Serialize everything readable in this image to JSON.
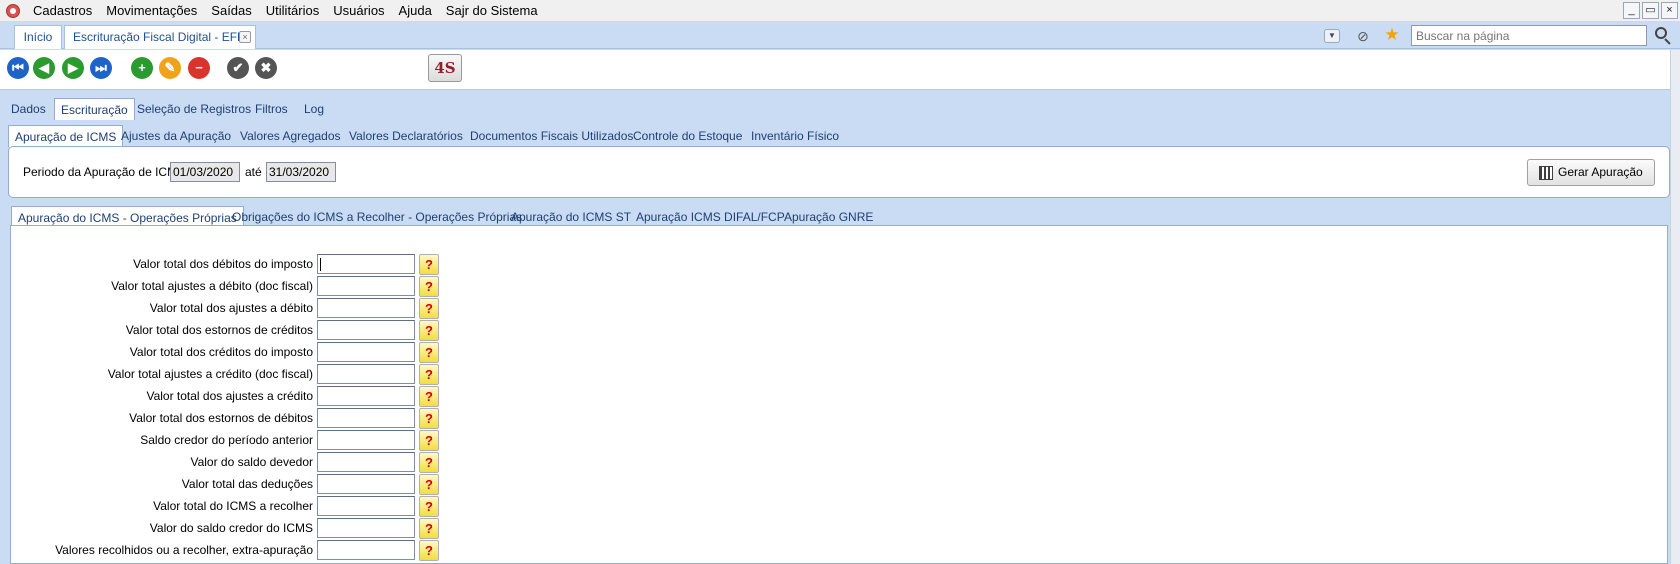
{
  "menu": {
    "items": [
      "Cadastros",
      "Movimentações",
      "Saídas",
      "Utilitários",
      "Usuários",
      "Ajuda",
      "Sajr do Sistema"
    ]
  },
  "window_controls": [
    "_",
    "▭",
    "×"
  ],
  "doc_tabs": {
    "home": "Início",
    "efd": "Escrituração Fiscal Digital - EFD"
  },
  "search": {
    "placeholder": "Buscar na página"
  },
  "toolbar": {
    "buttons": [
      {
        "icon": "first-record-icon",
        "glyph": "⏮",
        "color": "#1e63c8"
      },
      {
        "icon": "previous-record-icon",
        "glyph": "◀",
        "color": "#2b9a2f"
      },
      {
        "icon": "next-record-icon",
        "glyph": "▶",
        "color": "#2b9a2f"
      },
      {
        "icon": "last-record-icon",
        "glyph": "⏭",
        "color": "#1e63c8"
      },
      {
        "icon": "add-icon",
        "glyph": "+",
        "color": "#2b9a2f"
      },
      {
        "icon": "edit-icon",
        "glyph": "✎",
        "color": "#f1a21a"
      },
      {
        "icon": "delete-icon",
        "glyph": "−",
        "color": "#d9342b"
      },
      {
        "icon": "confirm-icon",
        "glyph": "✔",
        "color": "#555555"
      },
      {
        "icon": "cancel-icon",
        "glyph": "✖",
        "color": "#555555"
      }
    ],
    "logo_text": "4S"
  },
  "main_tabs": [
    "Dados",
    "Escrituração",
    "Seleção de Registros",
    "Filtros",
    "Log"
  ],
  "main_tabs_active": "Escrituração",
  "esc_tabs": [
    "Apuração de ICMS",
    "Ajustes da Apuração",
    "Valores Agregados",
    "Valores Declaratórios",
    "Documentos Fiscais Utilizados",
    "Controle do Estoque",
    "Inventário Físico"
  ],
  "esc_tabs_active": "Apuração de ICMS",
  "period": {
    "label": "Periodo da Apuração de ICMS",
    "start": "01/03/2020",
    "until_label": "até",
    "end": "31/03/2020",
    "generate_label": "Gerar Apuração"
  },
  "sub_tabs": [
    "Apuração do ICMS - Operações Próprias",
    "Obrigações do ICMS a Recolher - Operações Próprias",
    "Apuração do ICMS ST",
    "Apuração ICMS DIFAL/FCP",
    "Apuração GNRE"
  ],
  "sub_tabs_active": "Apuração do ICMS - Operações Próprias",
  "fields": [
    {
      "label": "Valor total dos débitos do imposto",
      "value": ""
    },
    {
      "label": "Valor total ajustes a débito (doc fiscal)",
      "value": ""
    },
    {
      "label": "Valor total dos ajustes a débito",
      "value": ""
    },
    {
      "label": "Valor total dos estornos de créditos",
      "value": ""
    },
    {
      "label": "Valor total dos créditos do imposto",
      "value": ""
    },
    {
      "label": "Valor total ajustes a crédito (doc fiscal)",
      "value": ""
    },
    {
      "label": "Valor total dos ajustes a crédito",
      "value": ""
    },
    {
      "label": "Valor total dos estornos de débitos",
      "value": ""
    },
    {
      "label": "Saldo credor do período anterior",
      "value": ""
    },
    {
      "label": "Valor do saldo devedor",
      "value": ""
    },
    {
      "label": "Valor total das deduções",
      "value": ""
    },
    {
      "label": "Valor total do ICMS a recolher",
      "value": ""
    },
    {
      "label": "Valor do saldo credor do ICMS",
      "value": ""
    },
    {
      "label": "Valores recolhidos ou a recolher, extra-apuração",
      "value": ""
    }
  ],
  "help_glyph": "?"
}
